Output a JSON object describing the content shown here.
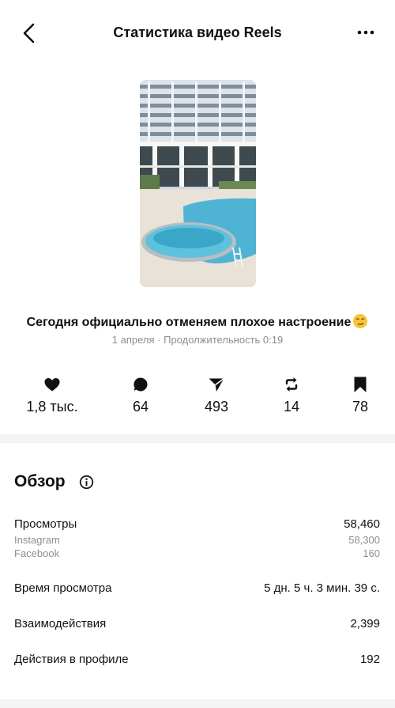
{
  "header": {
    "title": "Статистика видео Reels",
    "back_icon": "chevron-left-icon",
    "more_icon": "more-horizontal-icon"
  },
  "post": {
    "caption": "Сегодня официально отменяем плохое настроение",
    "caption_emoji": "smirking-face-emoji",
    "meta": "1 апреля · Продолжительность 0:19"
  },
  "stats": {
    "likes": "1,8 тыс.",
    "comments": "64",
    "shares": "493",
    "reposts": "14",
    "saves": "78"
  },
  "overview": {
    "title": "Обзор",
    "views_label": "Просмотры",
    "views_value": "58,460",
    "instagram_label": "Instagram",
    "instagram_value": "58,300",
    "facebook_label": "Facebook",
    "facebook_value": "160",
    "watch_time_label": "Время просмотра",
    "watch_time_value": "5 дн. 5 ч. 3 мин. 39 с.",
    "interactions_label": "Взаимодействия",
    "interactions_value": "2,399",
    "profile_actions_label": "Действия в профиле",
    "profile_actions_value": "192"
  },
  "colors": {
    "text": "#111111",
    "secondary": "#8e8e8e",
    "divider": "#f4f4f4",
    "pool": "#5fb8d6"
  }
}
